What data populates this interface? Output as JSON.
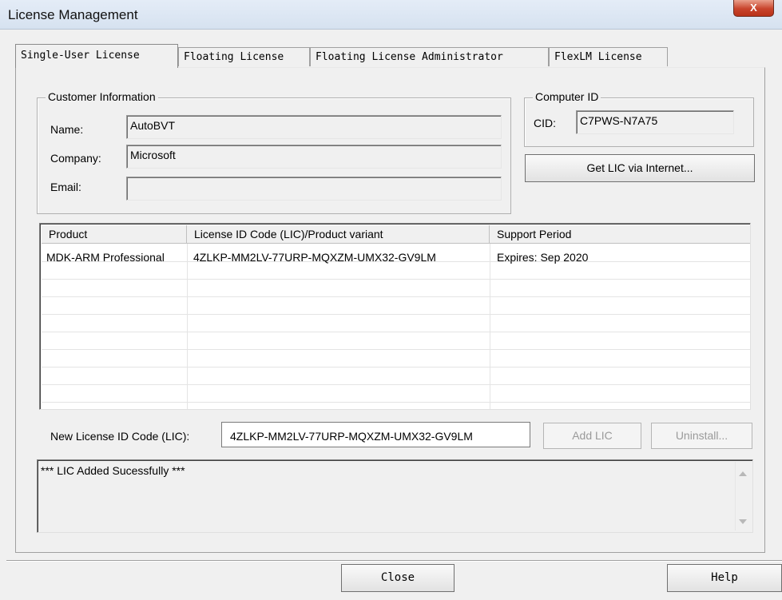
{
  "window": {
    "title": "License Management",
    "close_glyph": "X"
  },
  "tabs": [
    {
      "label": "Single-User License",
      "active": true
    },
    {
      "label": "Floating License",
      "active": false
    },
    {
      "label": "Floating License Administrator",
      "active": false
    },
    {
      "label": "FlexLM License",
      "active": false
    }
  ],
  "customer": {
    "group_label": "Customer Information",
    "name_label": "Name:",
    "name_value": "AutoBVT",
    "company_label": "Company:",
    "company_value": "Microsoft",
    "email_label": "Email:",
    "email_value": ""
  },
  "computer": {
    "group_label": "Computer ID",
    "cid_label": "CID:",
    "cid_value": "C7PWS-N7A75",
    "get_lic_button": "Get LIC via Internet..."
  },
  "license_table": {
    "columns": [
      "Product",
      "License ID Code (LIC)/Product variant",
      "Support Period"
    ],
    "rows": [
      [
        "MDK-ARM Professional",
        "4ZLKP-MM2LV-77URP-MQXZM-UMX32-GV9LM",
        "Expires: Sep 2020"
      ]
    ]
  },
  "new_lic": {
    "label": "New License ID Code (LIC):",
    "value": "4ZLKP-MM2LV-77URP-MQXZM-UMX32-GV9LM",
    "add_button": "Add LIC",
    "uninstall_button": "Uninstall..."
  },
  "status_message": "*** LIC Added Sucessfully ***",
  "footer": {
    "close_button": "Close",
    "help_button": "Help"
  }
}
